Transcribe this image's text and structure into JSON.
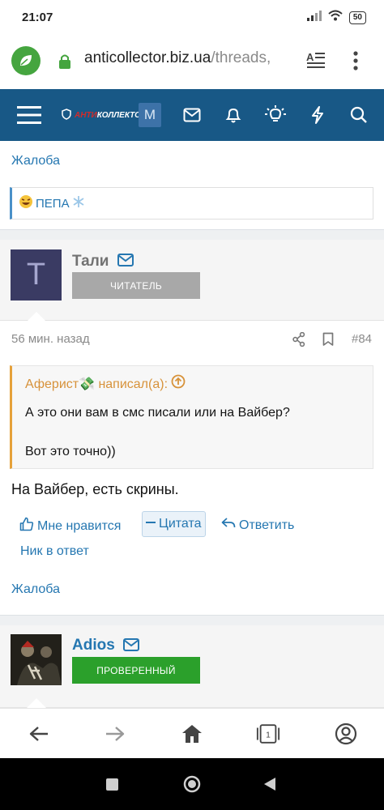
{
  "status_bar": {
    "time": "21:07",
    "battery": "50"
  },
  "browser": {
    "url_host": "anticollector.biz.ua",
    "url_path": "/threads,"
  },
  "forum_nav": {
    "logo_prefix": "АНТИ",
    "logo_suffix": "КОЛЛЕКТОР",
    "m_label": "M",
    "bar_color": "#185886"
  },
  "prev_post": {
    "complaint": "Жалоба",
    "signature": "ПЕПА"
  },
  "post": {
    "username": "Тали",
    "avatar_letter": "Т",
    "banner": "ЧИТАТЕЛЬ",
    "time": "56 мин. назад",
    "number": "#84",
    "quote_author": "Аферист💸 написал(а):",
    "quote_line1": "А это они вам в смс писали или на Вайбер?",
    "quote_line2": "Вот это точно))",
    "body": "На Вайбер, есть скрины.",
    "actions": {
      "like": "Мне нравится",
      "quote": "Цитата",
      "reply": "Ответить",
      "mention": "Ник в ответ"
    },
    "complaint": "Жалоба"
  },
  "next_post": {
    "username": "Adios",
    "banner": "ПРОВЕРЕННЫЙ"
  },
  "bottom_nav": {
    "tab_count": "1"
  },
  "colors": {
    "link": "#2577b1",
    "quote_accent": "#e5a13a",
    "banner_gray": "#a8a8a8",
    "banner_green": "#2ba02b"
  }
}
